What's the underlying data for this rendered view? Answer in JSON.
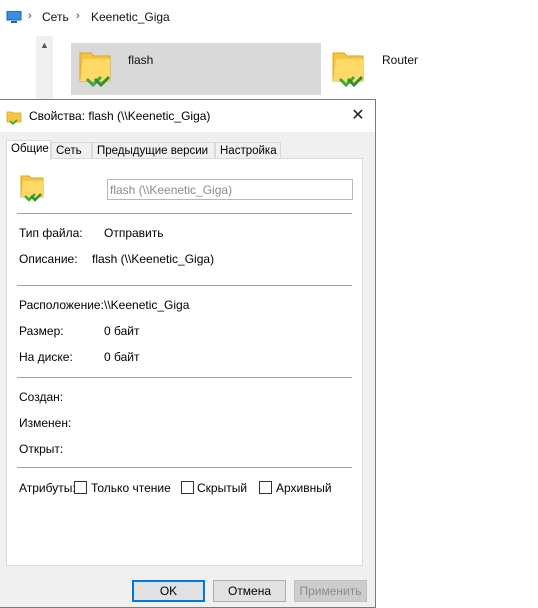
{
  "explorer": {
    "breadcrumb": [
      "Сеть",
      "Keenetic_Giga"
    ],
    "tiles": [
      {
        "label": "flash",
        "selected": true
      },
      {
        "label": "Router",
        "selected": false
      }
    ]
  },
  "dialog": {
    "title": "Свойства: flash (\\\\Keenetic_Giga)",
    "close_glyph": "✕",
    "tabs": [
      "Общие",
      "Сеть",
      "Предыдущие версии",
      "Настройка"
    ],
    "active_tab": "Общие",
    "name_value": "flash (\\\\Keenetic_Giga)",
    "fields": {
      "type": {
        "label": "Тип файла:",
        "value": "Отправить"
      },
      "description": {
        "label": "Описание:",
        "value": "flash (\\\\Keenetic_Giga)"
      },
      "location": {
        "label": "Расположение:",
        "value": "\\\\Keenetic_Giga"
      },
      "size": {
        "label": "Размер:",
        "value": "0 байт"
      },
      "size_on_disk": {
        "label": "На диске:",
        "value": "0 байт"
      },
      "created": {
        "label": "Создан:",
        "value": ""
      },
      "modified": {
        "label": "Изменен:",
        "value": ""
      },
      "accessed": {
        "label": "Открыт:",
        "value": ""
      }
    },
    "attributes": {
      "label": "Атрибуты:",
      "read_only": {
        "label": "Только чтение",
        "checked": false
      },
      "hidden": {
        "label": "Скрытый",
        "checked": false
      },
      "archive": {
        "label": "Архивный",
        "checked": false
      }
    },
    "buttons": {
      "ok": "OK",
      "cancel": "Отмена",
      "apply": "Применить"
    }
  },
  "colors": {
    "accent": "#0078d7",
    "folder": "#f5c542",
    "share": "#3ea83e",
    "selection": "#d9d9d9"
  }
}
